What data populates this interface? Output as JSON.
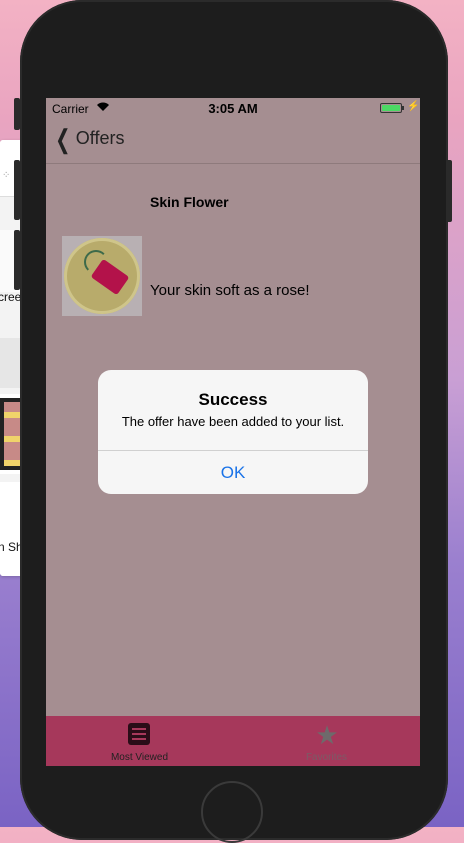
{
  "background_window": {
    "fragment_text_1": "cree",
    "fragment_text_2": "n Sh"
  },
  "status_bar": {
    "carrier": "Carrier",
    "time": "3:05 AM"
  },
  "nav": {
    "back_label": "Offers"
  },
  "offer": {
    "title": "Skin Flower",
    "description": "Your skin soft as a rose!"
  },
  "tabs": [
    {
      "label": "Most Viewed",
      "icon": "list-icon"
    },
    {
      "label": "Favorites",
      "icon": "star-icon"
    }
  ],
  "alert": {
    "title": "Success",
    "message": "The offer have been added to your list.",
    "ok_label": "OK"
  },
  "colors": {
    "tab_bar": "#a6385b",
    "alert_button": "#1a73e8",
    "battery": "#4cd964"
  }
}
